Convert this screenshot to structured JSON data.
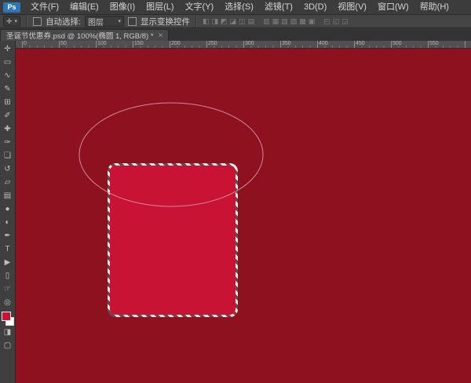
{
  "app": {
    "logo_text": "Ps"
  },
  "menu_bar": {
    "items": [
      {
        "id": "file",
        "label": "文件(F)"
      },
      {
        "id": "edit",
        "label": "编辑(E)"
      },
      {
        "id": "image",
        "label": "图像(I)"
      },
      {
        "id": "layer",
        "label": "图层(L)"
      },
      {
        "id": "type",
        "label": "文字(Y)"
      },
      {
        "id": "select",
        "label": "选择(S)"
      },
      {
        "id": "filter",
        "label": "滤镜(T)"
      },
      {
        "id": "3d",
        "label": "3D(D)"
      },
      {
        "id": "view",
        "label": "视图(V)"
      },
      {
        "id": "window",
        "label": "窗口(W)"
      },
      {
        "id": "help",
        "label": "帮助(H)"
      }
    ]
  },
  "options_bar": {
    "tool_preset_glyph": "✛",
    "dropdown_arrow_glyph": "▾",
    "auto_select_label": "自动选择:",
    "auto_select_value": "图层",
    "auto_select_checked": false,
    "show_transform_label": "显示变换控件",
    "show_transform_checked": false,
    "align_icons": [
      {
        "name": "align-top-edges",
        "glyph": "◧"
      },
      {
        "name": "align-vertical-centers",
        "glyph": "◨"
      },
      {
        "name": "align-bottom-edges",
        "glyph": "◩"
      },
      {
        "name": "align-left-edges",
        "glyph": "◪"
      },
      {
        "name": "align-horizontal-centers",
        "glyph": "◫"
      },
      {
        "name": "align-right-edges",
        "glyph": "▤"
      },
      {
        "name": "distribute-top-edges",
        "glyph": "▥"
      },
      {
        "name": "distribute-vertical-centers",
        "glyph": "▦"
      },
      {
        "name": "distribute-bottom-edges",
        "glyph": "▧"
      },
      {
        "name": "distribute-left-edges",
        "glyph": "▨"
      },
      {
        "name": "distribute-horizontal-centers",
        "glyph": "▩"
      },
      {
        "name": "distribute-right-edges",
        "glyph": "▣"
      },
      {
        "name": "distribute-horizontal-spacing",
        "glyph": "◰"
      },
      {
        "name": "distribute-vertical-spacing",
        "glyph": "◱"
      },
      {
        "name": "auto-align-layers",
        "glyph": "◲"
      }
    ]
  },
  "document_tab": {
    "title": "圣诞节优惠券.psd @ 100%(椭圆 1, RGB/8) *",
    "close_glyph": "×"
  },
  "ruler": {
    "ticks": [
      "0",
      "50",
      "100",
      "150",
      "200",
      "250",
      "300",
      "350",
      "400",
      "450",
      "500",
      "550"
    ]
  },
  "tool_bar": {
    "tools": [
      {
        "name": "move-tool",
        "glyph": "✛"
      },
      {
        "name": "marquee-tool",
        "glyph": "▭"
      },
      {
        "name": "lasso-tool",
        "glyph": "∿"
      },
      {
        "name": "quick-selection-tool",
        "glyph": "✎"
      },
      {
        "name": "crop-tool",
        "glyph": "⊞"
      },
      {
        "name": "eyedropper-tool",
        "glyph": "✐"
      },
      {
        "name": "healing-brush-tool",
        "glyph": "✚"
      },
      {
        "name": "brush-tool",
        "glyph": "✑"
      },
      {
        "name": "clone-stamp-tool",
        "glyph": "❏"
      },
      {
        "name": "history-brush-tool",
        "glyph": "↺"
      },
      {
        "name": "eraser-tool",
        "glyph": "▱"
      },
      {
        "name": "gradient-tool",
        "glyph": "▤"
      },
      {
        "name": "blur-tool",
        "glyph": "●"
      },
      {
        "name": "dodge-tool",
        "glyph": "◐"
      },
      {
        "name": "pen-tool",
        "glyph": "✒"
      },
      {
        "name": "type-tool",
        "glyph": "T"
      },
      {
        "name": "path-selection-tool",
        "glyph": "▶"
      },
      {
        "name": "shape-tool",
        "glyph": "▯"
      },
      {
        "name": "hand-tool",
        "glyph": "☞"
      },
      {
        "name": "zoom-tool",
        "glyph": "◎"
      }
    ],
    "bottom_tools": [
      {
        "name": "quick-mask-mode-button",
        "glyph": "◨"
      },
      {
        "name": "screen-mode-button",
        "glyph": "▢"
      }
    ],
    "foreground_color": "#c91334",
    "background_color_swatch": "#ffffff"
  },
  "canvas": {
    "background_color": "#8e1120",
    "rectangle_fill": "#c91334",
    "ellipse_stroke": "#d4888f"
  }
}
